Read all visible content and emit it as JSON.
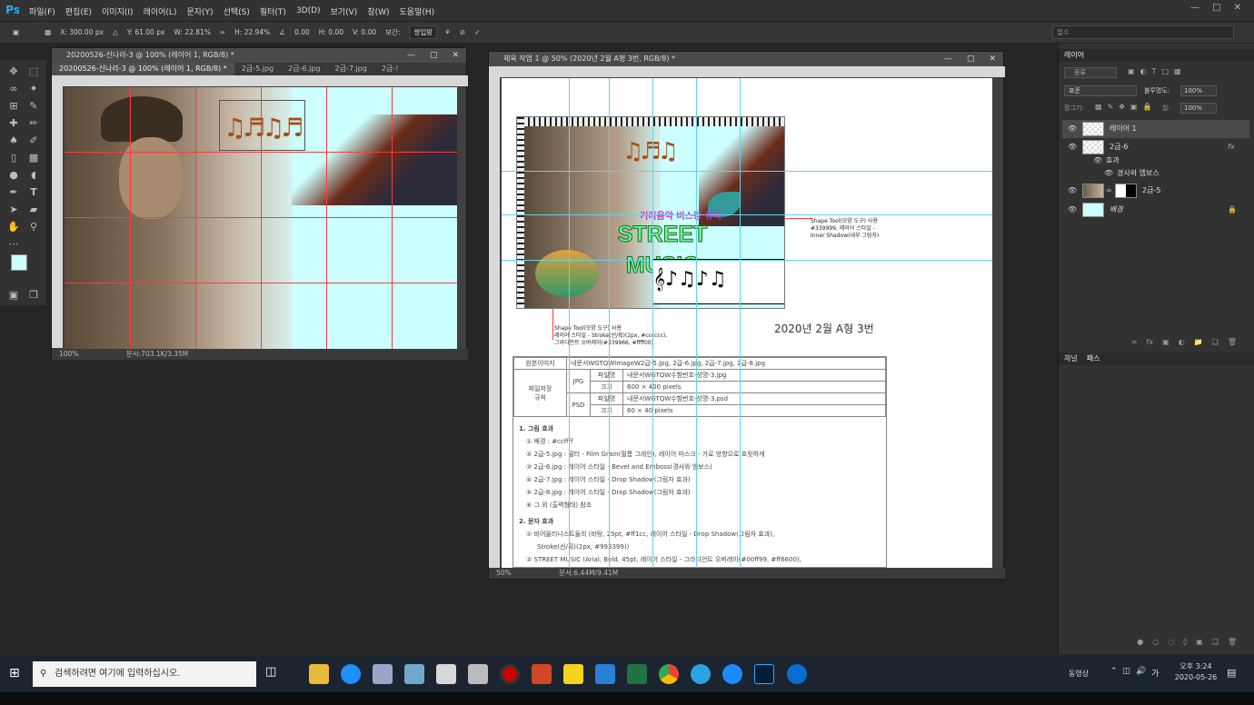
{
  "app": {
    "logo": "Ps"
  },
  "menu": [
    "파일(F)",
    "편집(E)",
    "이미지(I)",
    "레이어(L)",
    "문자(Y)",
    "선택(S)",
    "필터(T)",
    "3D(D)",
    "보기(V)",
    "창(W)",
    "도움말(H)"
  ],
  "options": {
    "x": "X: 300.00 px",
    "y": "Y: 61.00 px",
    "w": "W: 22.81%",
    "h": "H: 22.94%",
    "angle": "0.00",
    "hskew": "H: 0.00",
    "vskew": "V: 0.00",
    "interp_label": "보간:",
    "interp": "쌍입방",
    "search_placeholder": "필수"
  },
  "doc1": {
    "title": "20200526-신나라-3 @ 100% (레이어 1, RGB/8) *",
    "tabs": [
      "20200526-신나라-3 @ 100% (레이어 1, RGB/8) *",
      "2급-5.jpg",
      "2급-6.jpg",
      "2급-7.jpg",
      "2급-!"
    ],
    "zoom": "100%",
    "docsize": "문서:703.1K/3.35M"
  },
  "doc2": {
    "title": "체육 작업 1 @ 50% (2020년 2월 A형 3번, RGB/8) *",
    "zoom": "50%",
    "docsize": "문서:6.44M/9.41M",
    "heading": "2020년 2월 A형 3번",
    "annot1": "Shape Tool(모양 도구) 사용\n#339999, 레이어 스타일 -\nInner Shadow(내부 그림자)",
    "annot2": "Shape Tool(모양 도구) 사용\n레이어 스타일 - Stroke(선/획)(2px, #cccccc),\n그라디언트 오버레이(#339966, #ffff00)",
    "title_kr": "거리음악 버스킹 뮤직",
    "street_music": "STREET MUSIC",
    "spec": {
      "r1c1": "원본이미지",
      "r1c2": "내문서WGTQWImageW2급-5.jpg, 2급-6.jpg, 2급-7.jpg, 2급-8.jpg",
      "rule": "파일저장\n규칙",
      "jpg": "JPG",
      "psd": "PSD",
      "fname": "파일명",
      "size": "크기",
      "jpg_name": "내문서WGTQW수험번호-성명-3.jpg",
      "jpg_size": "600 × 400 pixels",
      "psd_name": "내문서WGTQW수험번호-성명-3.psd",
      "psd_size": "60 × 40 pixels"
    },
    "sec1": "1. 그림 효과",
    "items1": [
      "① 배경 : #ccffff",
      "② 2급-5.jpg : 필터 - Film Grain(필름 그레인), 레이어 마스크 - 가로 방향으로 흐릿하게",
      "③ 2급-6.jpg : 레이어 스타일 - Bevel and Emboss(경사와 엠보스)",
      "④ 2급-7.jpg : 레이어 스타일 - Drop Shadow(그림자 효과)",
      "⑤ 2급-8.jpg : 레이어 스타일 - Drop Shadow(그림자 효과)",
      "⑥ 그 외 (출력형태) 참조"
    ],
    "sec2": "2. 문자 효과",
    "items2": [
      "① 비어올리니스트들의 (바탕, 25pt, #ff1cc, 레이어 스타일 - Drop Shadow(그림자 효과),",
      "Stroke(선/획)(2px, #993399))",
      "② STREET MUSIC (Arial, Bold, 45pt, 레이어 스타일 - 그라디언트 오버레이(#00ff99, #ff6600),"
    ]
  },
  "layers_panel": {
    "title": "레이어",
    "kind": "종류",
    "blend": "표준",
    "opacity_label": "불투명도:",
    "opacity": "100%",
    "lock_label": "잠그기:",
    "fill_label": "칠:",
    "fill": "100%",
    "layers": [
      {
        "name": "레이어 1"
      },
      {
        "name": "2급-6",
        "fx": "fx"
      },
      {
        "name": "효과"
      },
      {
        "name": "경사와 엠보스"
      },
      {
        "name": "2급-5"
      },
      {
        "name": "배경"
      }
    ],
    "tabs2": [
      "채널",
      "패스"
    ]
  },
  "taskbar": {
    "search": "검색하려면 여기에 입력하십시오.",
    "tray_label": "동영상",
    "ime": "가",
    "time": "오후 3:24",
    "date": "2020-05-26"
  },
  "colors": {
    "bg_doc": "#ccffff",
    "guide_red": "#ff3b3b",
    "guide_cyan": "#5fd3f0",
    "ps_blue": "#31a8ff"
  }
}
